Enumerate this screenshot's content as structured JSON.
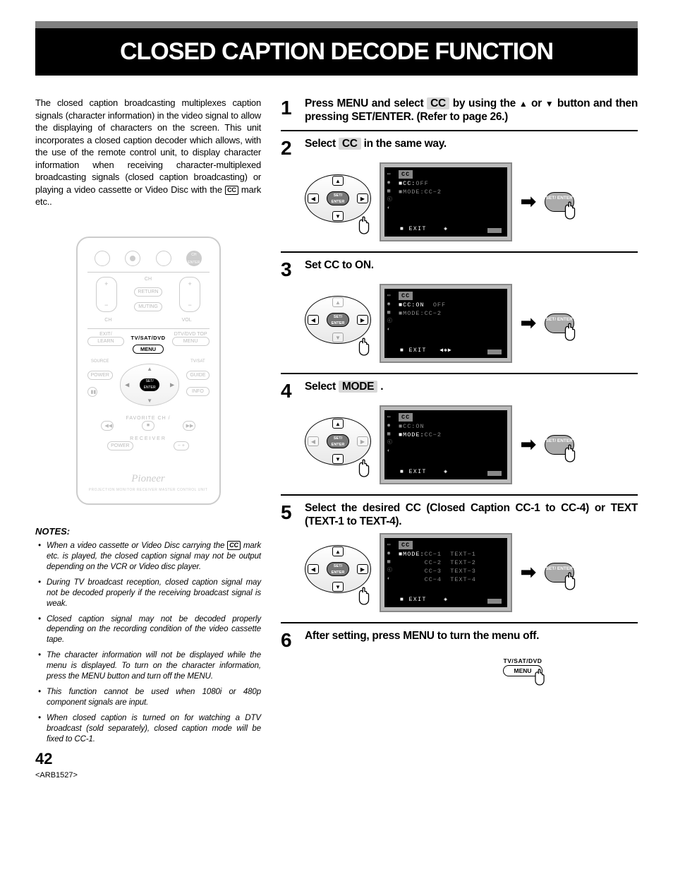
{
  "title": "CLOSED CAPTION DECODE FUNCTION",
  "page_number": "42",
  "doc_code": "<ARB1527>",
  "intro": "The closed caption broadcasting multiplexes caption signals (character information) in the video signal to allow the displaying of characters on the screen. This unit incorporates a closed caption decoder which allows, with the use of the remote control unit, to display character information when receiving character-multiplexed broadcasting signals (closed caption broadcasting) or playing a video cassette or Video Disc with the ",
  "intro_suffix": " mark etc..",
  "cc_symbol": "CC",
  "remote": {
    "brand": "Pioneer",
    "menu_strip": "TV/SAT/DVD",
    "menu_btn": "MENU",
    "set_enter": "SET/\nENTER",
    "labels": {
      "ch": "CH",
      "vol": "VOL",
      "return": "RETURN",
      "muting": "MUTING",
      "learn": "LEARN",
      "menu_r": "MENU",
      "exit": "EXIT/",
      "dtv_dvd_top": "DTV/DVD TOP",
      "source": "SOURCE",
      "guide": "GUIDE",
      "power": "POWER",
      "info": "INFO",
      "tv_sat": "TV/SAT",
      "dtv_sat": "DTV/SAT",
      "receiver": "RECEIVER",
      "favorite": "FAVORITE CH / ",
      "ch_enter": "CH\nENTER",
      "sub": "PROJECTION MONITOR RECEIVER\nMASTER CONTROL UNIT"
    }
  },
  "notes_heading": "NOTES:",
  "notes": [
    {
      "pre": "When a video cassette or Video Disc carrying the ",
      "post": " mark etc. is played, the closed caption signal may not be output depending on the VCR or Video disc player."
    },
    {
      "text": "During TV broadcast reception, closed caption signal may not be decoded properly if the receiving broadcast signal is weak."
    },
    {
      "text": "Closed caption signal may not be decoded properly depending on the recording condition of the video cassette tape."
    },
    {
      "text": "The character information will not be displayed while the menu is displayed. To turn on the character information, press the MENU button and turn off the MENU."
    },
    {
      "text": "This function cannot be used when 1080i or 480p component signals are input."
    },
    {
      "text": "When closed caption is turned on for watching a DTV broadcast (sold separately), closed caption mode will be fixed to CC-1."
    }
  ],
  "steps": {
    "s1": {
      "pre": "Press MENU and select ",
      "hl": "CC",
      "mid": " by using the ",
      "tail": " button and then pressing SET/ENTER. (Refer to page 26.)"
    },
    "s2": {
      "pre": "Select ",
      "hl": "CC",
      "post": " in the same way."
    },
    "s3": {
      "text": "Set CC to ON."
    },
    "s4": {
      "pre": "Select ",
      "hl": "MODE",
      "post": " ."
    },
    "s5": {
      "text": "Select the desired CC (Closed Caption CC-1 to CC-4) or TEXT (TEXT-1 to TEXT-4)."
    },
    "s6": {
      "text": "After setting, press MENU to turn the menu off."
    }
  },
  "osd": {
    "header": "CC",
    "exit": "■ EXIT",
    "set_enter": "SET/\nENTER",
    "screen2": {
      "l1_a": "■CC:",
      "l1_b": "OFF",
      "l2_a": "■MODE:",
      "l2_b": "CC−2"
    },
    "screen3": {
      "l1_a": "■CC:",
      "l1_b": "ON",
      "l1_c": "OFF",
      "l2_a": "■MODE:",
      "l2_b": "CC−2"
    },
    "screen4": {
      "l1_a": "■CC:",
      "l1_b": "ON",
      "l2_a": "■MODE:",
      "l2_b": "CC−2"
    },
    "screen5": {
      "l1_a": "■MODE:",
      "c1": "CC−1",
      "t1": "TEXT−1",
      "c2": "CC−2",
      "t2": "TEXT−2",
      "c3": "CC−3",
      "t3": "TEXT−3",
      "c4": "CC−4",
      "t4": "TEXT−4"
    }
  },
  "menu_press": {
    "label": "TV/SAT/DVD",
    "button": "MENU"
  },
  "or_word": " or "
}
